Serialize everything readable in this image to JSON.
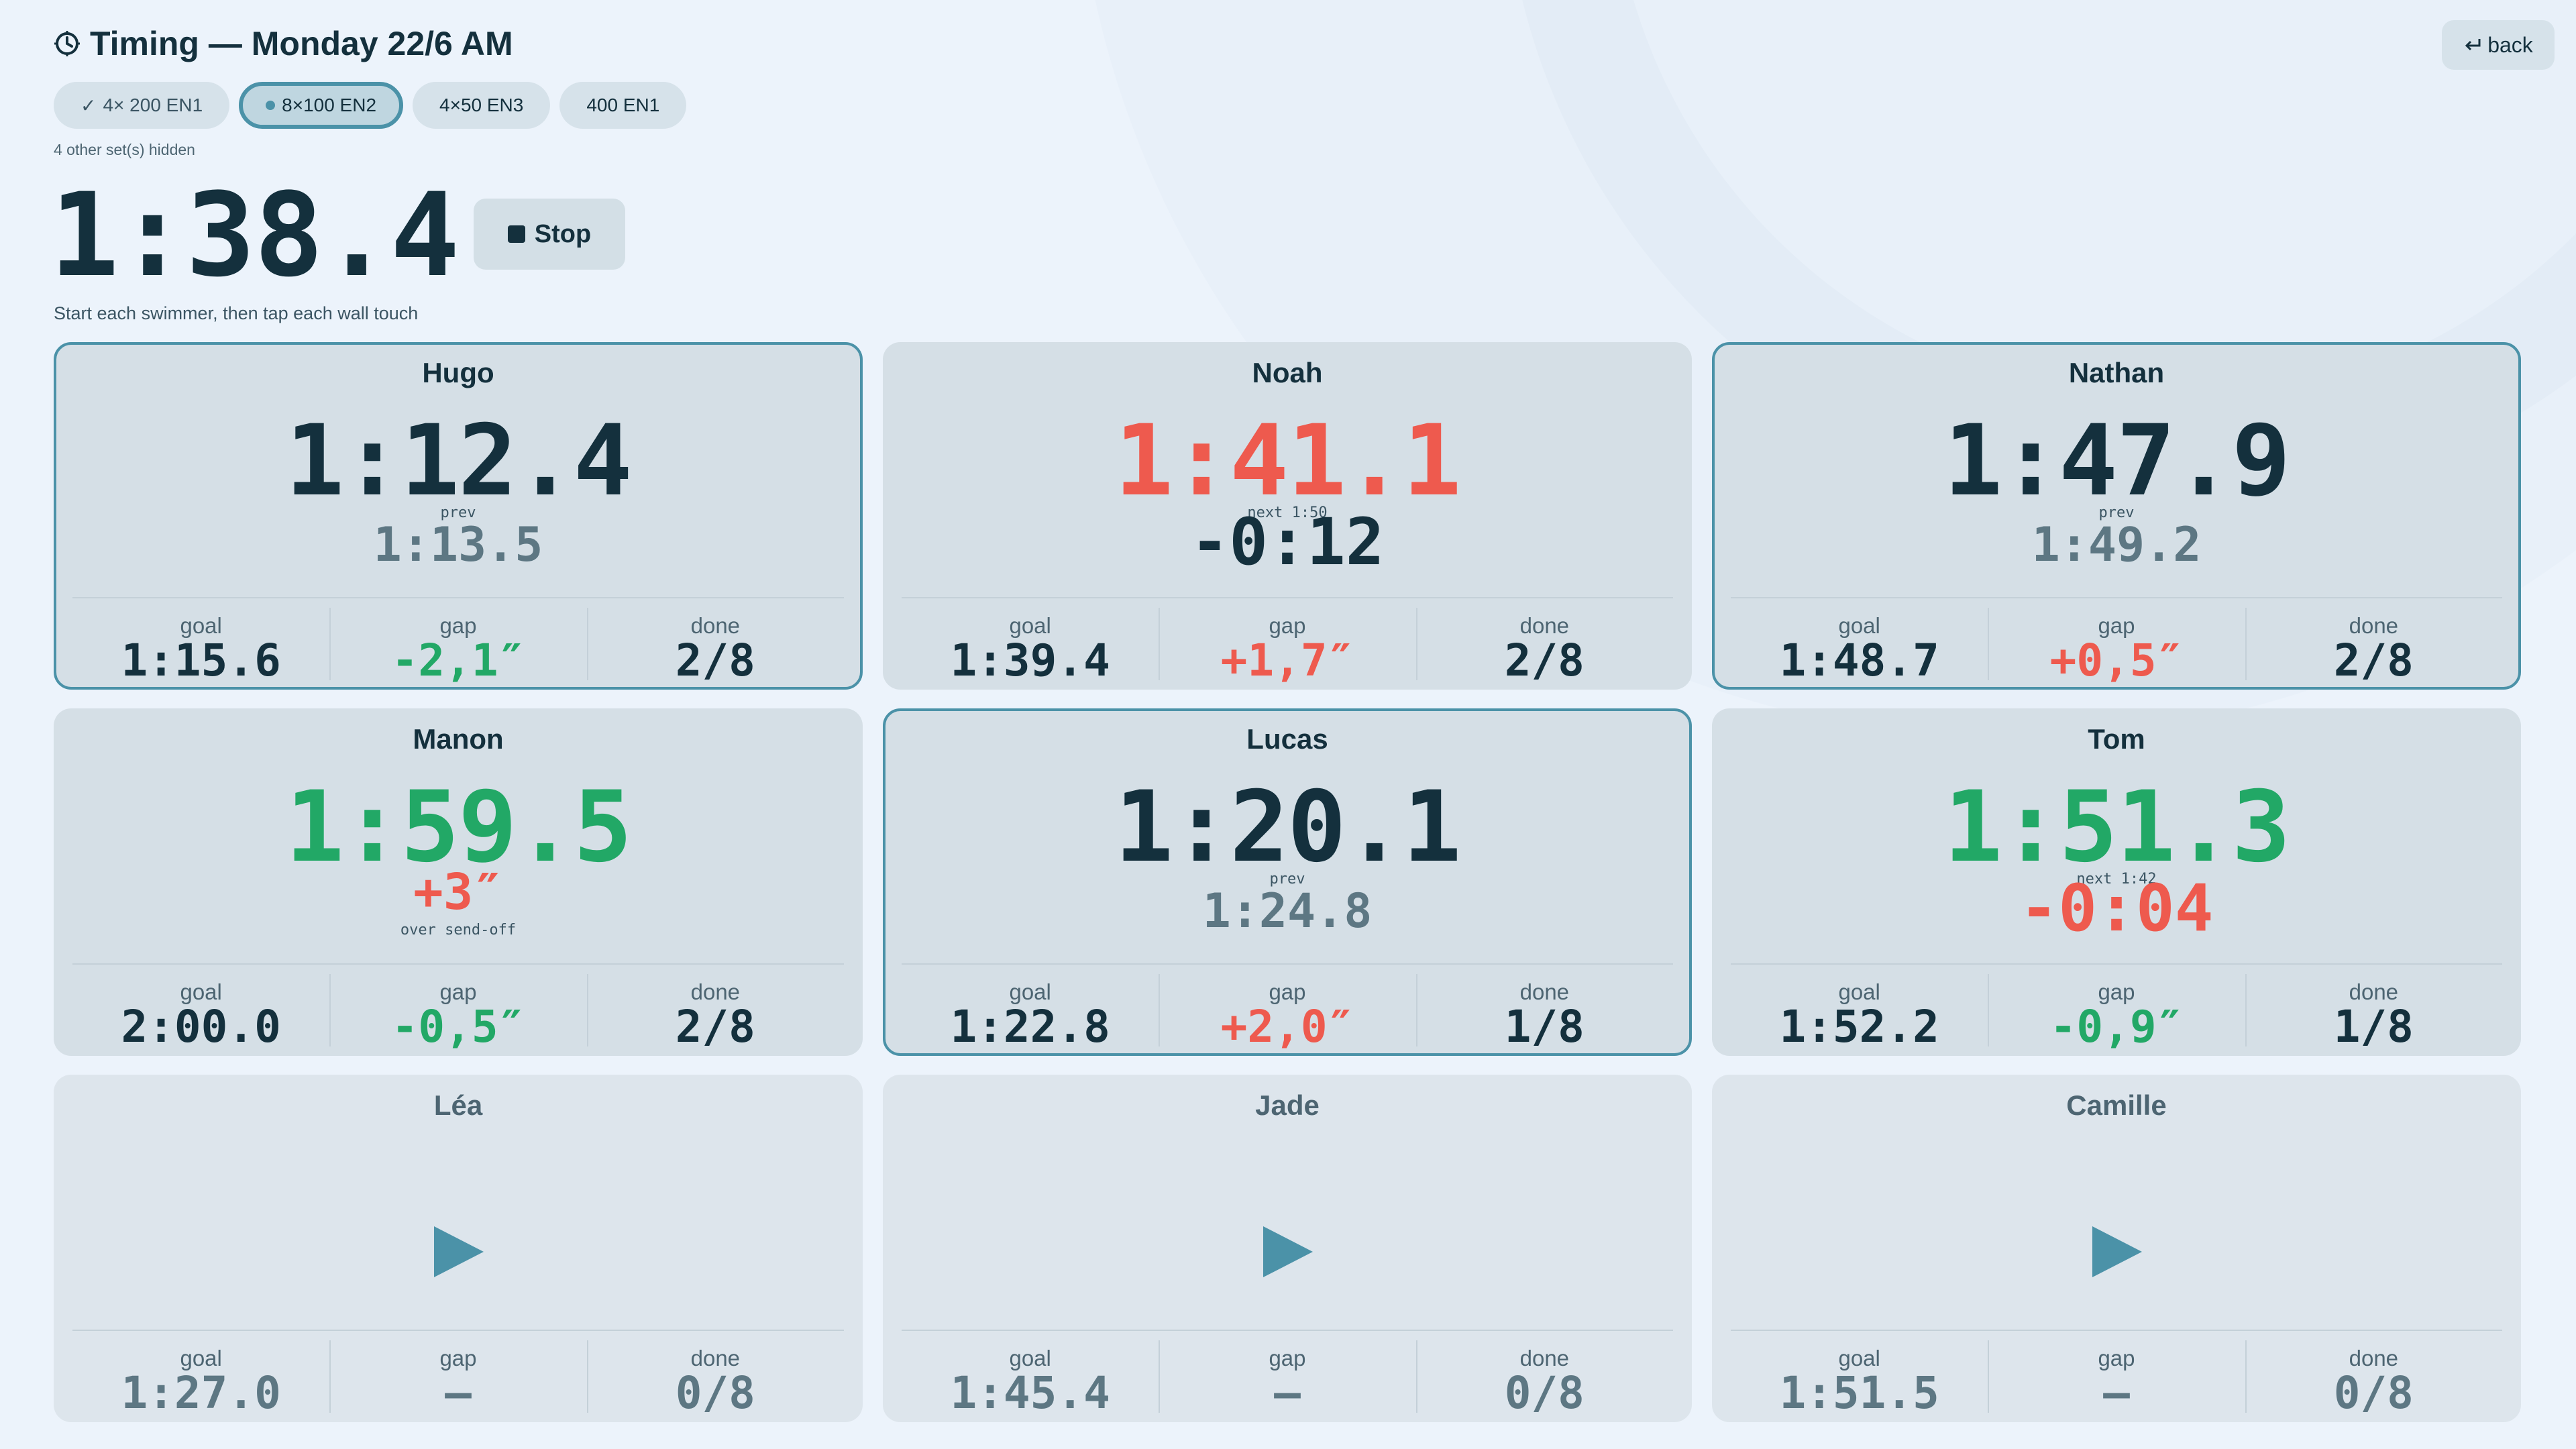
{
  "header": {
    "title": "Timing — Monday 22/6 AM",
    "back_label": "back"
  },
  "sets": {
    "chips": [
      {
        "label": "4× 200 EN1",
        "state": "done"
      },
      {
        "label": "8×100 EN2",
        "state": "active"
      },
      {
        "label": "4×50 EN3",
        "state": "upcoming"
      },
      {
        "label": "400 EN1",
        "state": "upcoming"
      }
    ],
    "hidden_note": "4 other set(s) hidden"
  },
  "timer": {
    "main_time": "1:38.4",
    "stop_label": "Stop",
    "instructions": "Start each swimmer, then tap each wall touch"
  },
  "labels": {
    "goal": "goal",
    "gap": "gap",
    "done": "done",
    "prev": "prev",
    "over": "over send-off"
  },
  "swimmers": [
    {
      "name": "Hugo",
      "time": "1:12.4",
      "sub_label": "prev",
      "sub_value": "1:13.5",
      "goal": "1:15.6",
      "gap": "-2,1″",
      "done": "2/8"
    },
    {
      "name": "Noah",
      "time": "1:41.1",
      "sub_label": "next 1:50",
      "sub_value": "-0:12",
      "goal": "1:39.4",
      "gap": "+1,7″",
      "done": "2/8"
    },
    {
      "name": "Nathan",
      "time": "1:47.9",
      "sub_label": "prev",
      "sub_value": "1:49.2",
      "goal": "1:48.7",
      "gap": "+0,5″",
      "done": "2/8"
    },
    {
      "name": "Manon",
      "time": "1:59.5",
      "over_value": "+3″",
      "over_label": "over send-off",
      "goal": "2:00.0",
      "gap": "-0,5″",
      "done": "2/8"
    },
    {
      "name": "Lucas",
      "time": "1:20.1",
      "sub_label": "prev",
      "sub_value": "1:24.8",
      "goal": "1:22.8",
      "gap": "+2,0″",
      "done": "1/8"
    },
    {
      "name": "Tom",
      "time": "1:51.3",
      "sub_label": "next 1:42",
      "sub_value": "-0:04",
      "goal": "1:52.2",
      "gap": "-0,9″",
      "done": "1/8"
    },
    {
      "name": "Léa",
      "goal": "1:27.0",
      "gap": "—",
      "done": "0/8"
    },
    {
      "name": "Jade",
      "goal": "1:45.4",
      "gap": "—",
      "done": "0/8"
    },
    {
      "name": "Camille",
      "goal": "1:51.5",
      "gap": "—",
      "done": "0/8"
    }
  ],
  "colors": {
    "accent": "#4b92a8",
    "negative": "#ee5a4e",
    "positive": "#22a866",
    "text": "#14303d",
    "card": "#d5dfe6",
    "background": "#ecf3fb"
  },
  "icons": {
    "title": "clock-icon",
    "back": "return-arrow-icon",
    "done_chip": "check-icon",
    "active_chip": "dot-icon",
    "stop": "stop-square-icon",
    "idle_start": "play-icon"
  }
}
